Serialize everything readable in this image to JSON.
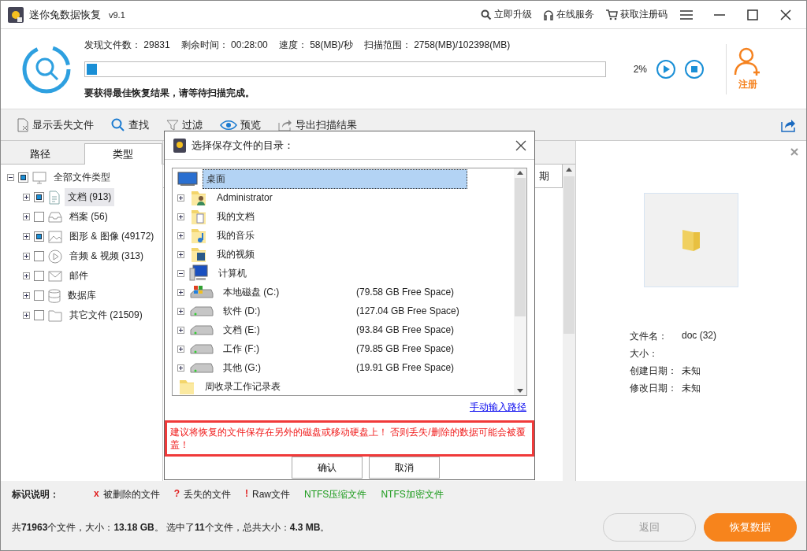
{
  "window": {
    "title": "迷你兔数据恢复",
    "version": "v9.1",
    "links": [
      "立即升级",
      "在线服务",
      "获取注册码"
    ]
  },
  "scan": {
    "stats": [
      {
        "label": "发现文件数：",
        "value": "29831"
      },
      {
        "label": "剩余时间：",
        "value": "00:28:00"
      },
      {
        "label": "速度：",
        "value": "58(MB)/秒"
      },
      {
        "label": "扫描范围：",
        "value": "2758(MB)/102398(MB)"
      }
    ],
    "level": 0.02,
    "percent": "2%",
    "hint": "要获得最佳恢复结果，请等待扫描完成。",
    "register": "注册"
  },
  "toolbar": [
    "显示丢失文件",
    "查找",
    "过滤",
    "预览",
    "导出扫描结果"
  ],
  "tabs": [
    {
      "label": "路径",
      "selected": false
    },
    {
      "label": "类型",
      "selected": true
    }
  ],
  "type_tree": [
    {
      "label": "全部文件类型",
      "checked": true,
      "selected": false,
      "expanded": true,
      "children": [
        {
          "label": "文档 (913)",
          "checked": true,
          "selected": true,
          "expanded": false
        },
        {
          "label": "档案 (56)",
          "checked": false,
          "selected": false,
          "expanded": false
        },
        {
          "label": "图形 & 图像 (49172)",
          "checked": true,
          "selected": false,
          "expanded": false
        },
        {
          "label": "音频 & 视频 (313)",
          "checked": false,
          "selected": false,
          "expanded": false
        },
        {
          "label": "邮件",
          "checked": false,
          "selected": false,
          "expanded": false
        },
        {
          "label": "数据库",
          "checked": false,
          "selected": false,
          "expanded": false
        },
        {
          "label": "其它文件 (21509)",
          "checked": false,
          "selected": false,
          "expanded": false
        }
      ]
    }
  ],
  "file_list": {
    "column_1": "期"
  },
  "preview": {
    "info": [
      {
        "label": "文件名：",
        "value": "doc (32)"
      },
      {
        "label": "大小："
      },
      {
        "label": "创建日期：",
        "value": "未知"
      },
      {
        "label": "修改日期：",
        "value": "未知"
      }
    ]
  },
  "legend": {
    "title": "标识说明：",
    "items": [
      {
        "mark": "x",
        "text": "被删除的文件"
      },
      {
        "mark": "?",
        "text": "丢失的文件"
      },
      {
        "mark": "!",
        "text": "Raw文件"
      },
      {
        "text": "NTFS压缩文件",
        "color": "#1a9a1a"
      },
      {
        "text": "NTFS加密文件",
        "color": "#1a9a1a"
      }
    ]
  },
  "status": "共**71963**个文件，大小：**13.18 GB**。 选中了**11**个文件，总共大小：**4.3 MB**。",
  "actions": [
    {
      "label": "返回",
      "disabled": true
    },
    {
      "label": "恢复数据",
      "disabled": false
    }
  ],
  "dialog": {
    "title": "选择保存文件的目录：",
    "tree": [
      {
        "label": "桌面",
        "kind": "desktop",
        "selected": true,
        "children": [
          {
            "label": "Administrator",
            "kind": "user-folder",
            "selected": false,
            "expanded": false
          },
          {
            "label": "我的文档",
            "kind": "doc-folder",
            "selected": false,
            "expanded": false
          },
          {
            "label": "我的音乐",
            "kind": "music-folder",
            "selected": false,
            "expanded": false
          },
          {
            "label": "我的视频",
            "kind": "video-folder",
            "selected": false,
            "expanded": false
          },
          {
            "label": "计算机",
            "kind": "computer",
            "selected": false,
            "expanded": true,
            "children": [
              {
                "label": "本地磁盘 (C:)",
                "free": "(79.58 GB Free Space)",
                "kind": "system-drive",
                "selected": false,
                "expanded": false
              },
              {
                "label": "软件 (D:)",
                "free": "(127.04 GB Free Space)",
                "kind": "drive",
                "selected": false,
                "expanded": false
              },
              {
                "label": "文档 (E:)",
                "free": "(93.84 GB Free Space)",
                "kind": "drive",
                "selected": false,
                "expanded": false
              },
              {
                "label": "工作 (F:)",
                "free": "(79.85 GB Free Space)",
                "kind": "drive",
                "selected": false,
                "expanded": false
              },
              {
                "label": "其他 (G:)",
                "free": "(19.91 GB Free Space)",
                "kind": "drive",
                "selected": false,
                "expanded": false
              }
            ]
          },
          {
            "label": "周收录工作记录表",
            "kind": "folder",
            "selected": false
          }
        ]
      }
    ],
    "manual_link": "手动输入路径",
    "warning": "建议将恢复的文件保存在另外的磁盘或移动硬盘上！ 否则丢失/删除的数据可能会被覆盖！",
    "buttons": [
      "确认",
      "取消"
    ]
  }
}
